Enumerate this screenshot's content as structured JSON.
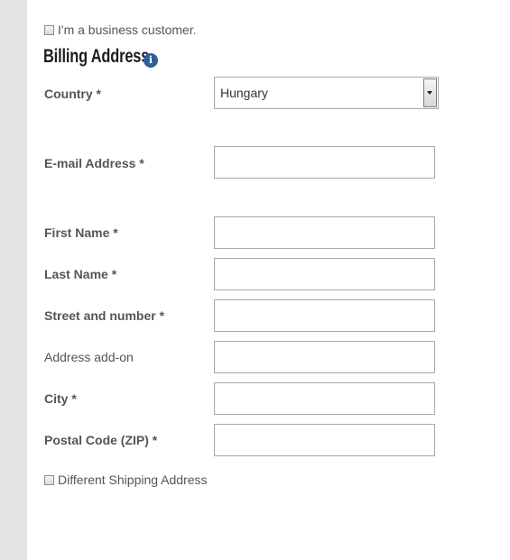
{
  "business_customer": {
    "label": "I'm a business customer.",
    "checked": false
  },
  "billing": {
    "title": "Billing Address",
    "info_icon": "info-icon"
  },
  "fields": {
    "country": {
      "label": "Country *",
      "value": "Hungary"
    },
    "email": {
      "label": "E-mail Address *",
      "value": ""
    },
    "first_name": {
      "label": "First Name *",
      "value": ""
    },
    "last_name": {
      "label": "Last Name *",
      "value": ""
    },
    "street": {
      "label": "Street and number *",
      "value": ""
    },
    "address_addon": {
      "label": "Address add-on",
      "value": ""
    },
    "city": {
      "label": "City *",
      "value": ""
    },
    "postal_code": {
      "label": "Postal Code (ZIP) *",
      "value": ""
    }
  },
  "different_shipping": {
    "label": "Different Shipping Address",
    "checked": false
  },
  "colors": {
    "sidebar": "#e4e4e4",
    "info_icon": "#2d5f9a",
    "label_text": "#555555",
    "title_text": "#1e1e1e",
    "input_border": "#a9a9a9"
  }
}
